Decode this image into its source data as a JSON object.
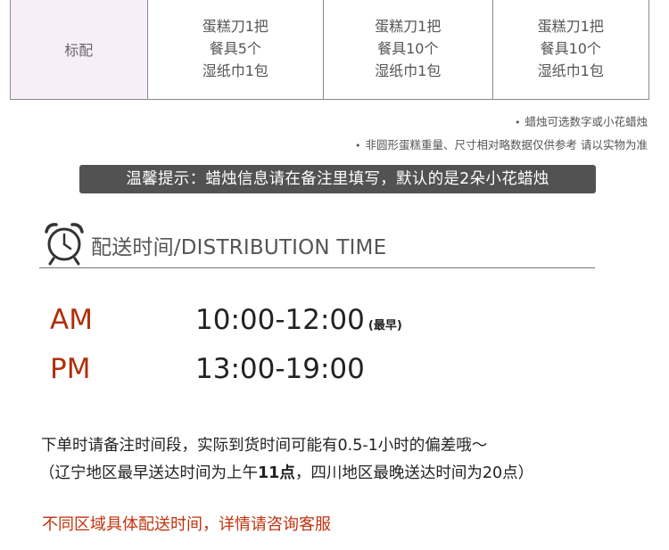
{
  "table": {
    "row_label": "标配",
    "columns": [
      {
        "lines": [
          "蛋糕刀1把",
          "餐具5个",
          "湿纸巾1包"
        ]
      },
      {
        "lines": [
          "蛋糕刀1把",
          "餐具10个",
          "湿纸巾1包"
        ]
      },
      {
        "lines": [
          "蛋糕刀1把",
          "餐具10个",
          "湿纸巾1包"
        ]
      }
    ]
  },
  "notes": {
    "bullet": "•",
    "line1": "蜡烛可选数字或小花蜡烛",
    "line2": "非圆形蛋糕重量、尺寸相对略数据仅供参考  请以实物为准"
  },
  "banner": "温馨提示：蜡烛信息请在备注里填写，默认的是2朵小花蜡烛",
  "delivery": {
    "title": "配送时间/DISTRIBUTION TIME",
    "icon": "alarm-clock-icon",
    "am_label": "AM",
    "am_time": "10:00-12:00",
    "am_note": "(最早)",
    "pm_label": "PM",
    "pm_time": "13:00-19:00"
  },
  "description": {
    "line1": "下单时请备注时间段，实际到货时间可能有0.5-1小时的偏差哦～",
    "line2_a": "（辽宁地区最早送达时间为上午",
    "line2_b": "11点",
    "line2_c": "，四川地区最晚送达时间为20点）"
  },
  "red_note": "不同区域具体配送时间，详情请咨询客服",
  "colors": {
    "accent_red": "#b0300b",
    "banner_bg": "#525252",
    "label_bg": "#f8eefa"
  }
}
